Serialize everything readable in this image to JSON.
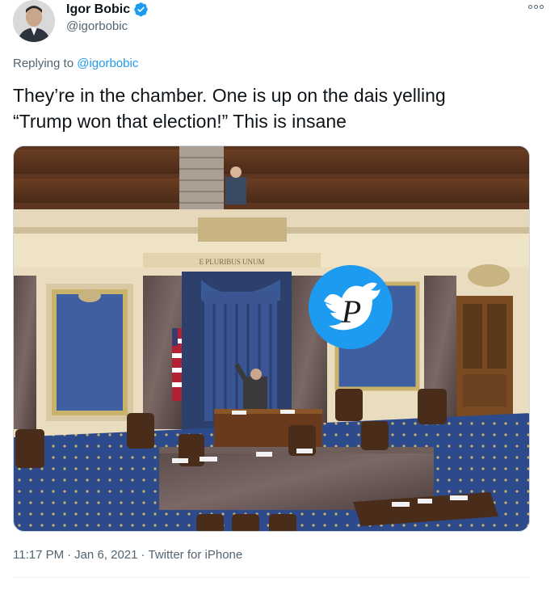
{
  "author": {
    "display_name": "Igor Bobic",
    "handle": "@igorbobic",
    "verified": true
  },
  "reply": {
    "prefix": "Replying to",
    "target": "@igorbobic"
  },
  "tweet": {
    "text_line1": "They’re in the chamber. One is up on the dais yelling",
    "text_line2": "“Trump won that election!” This is insane"
  },
  "media": {
    "icon": "chamber-photo",
    "inscription": "E PLURIBUS UNUM",
    "watermark_letter": "P"
  },
  "footer": {
    "time": "11:17 PM",
    "sep1": "·",
    "date": "Jan 6, 2021",
    "sep2": "·",
    "source": "Twitter for iPhone"
  },
  "colors": {
    "accent": "#1d9bf0",
    "text": "#0f1419",
    "secondary": "#536471"
  }
}
